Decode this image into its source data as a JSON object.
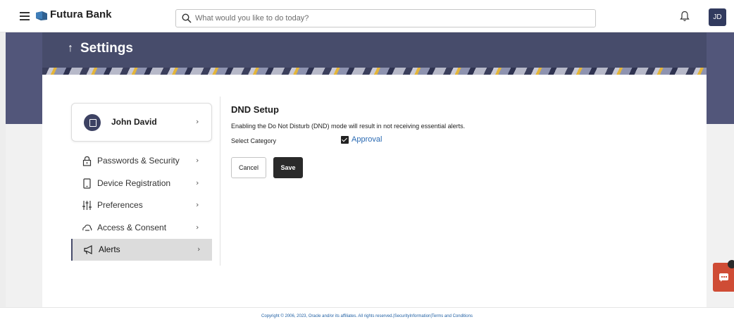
{
  "header": {
    "brand": "Futura Bank",
    "search_placeholder": "What would you like to do today?",
    "user_initials": "JD"
  },
  "page": {
    "title": "Settings",
    "back_icon": "↑"
  },
  "profile": {
    "name": "John David"
  },
  "menu": {
    "items": [
      {
        "label": "Passwords & Security",
        "icon": "lock-icon"
      },
      {
        "label": "Device Registration",
        "icon": "device-icon"
      },
      {
        "label": "Preferences",
        "icon": "sliders-icon"
      },
      {
        "label": "Access & Consent",
        "icon": "cloud-access-icon"
      },
      {
        "label": "Alerts",
        "icon": "megaphone-icon",
        "active": true
      }
    ],
    "chevron": "›"
  },
  "dnd": {
    "title": "DND Setup",
    "description": "Enabling the Do Not Disturb (DND) mode will result in not receiving essential alerts.",
    "category_label": "Select Category",
    "category_option": "Approval",
    "category_checked": true,
    "cancel_label": "Cancel",
    "save_label": "Save"
  },
  "footer": {
    "copyright": "Copyright © 2006, 2023, Oracle and/or its affiliates. All rights reserved.|SecurityInformation|Terms and Conditions"
  },
  "colors": {
    "header_band": "#474c6b",
    "accent_link": "#2a6ab3",
    "chat_button": "#cf4c35"
  }
}
